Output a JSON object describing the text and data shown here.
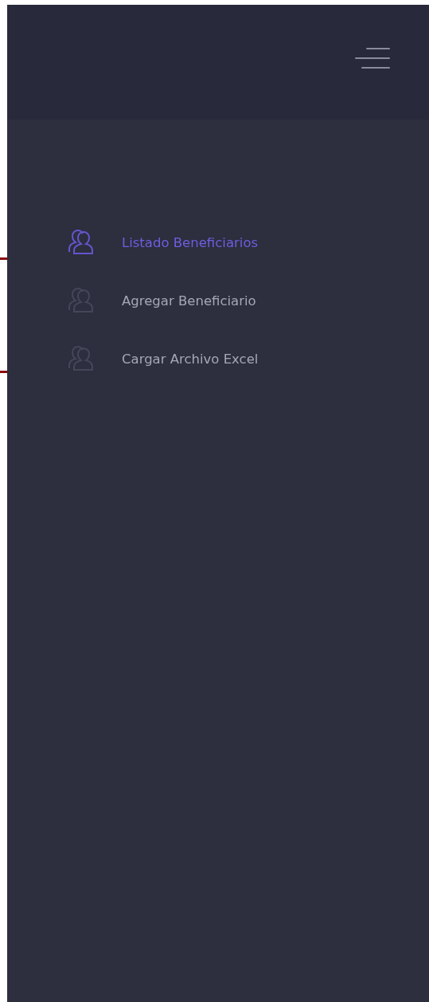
{
  "menu": [
    {
      "label": "Listado Beneficiarios",
      "selected": true
    },
    {
      "label": "Agregar Beneficiario",
      "selected": false
    },
    {
      "label": "Cargar Archivo Excel",
      "selected": false
    }
  ]
}
